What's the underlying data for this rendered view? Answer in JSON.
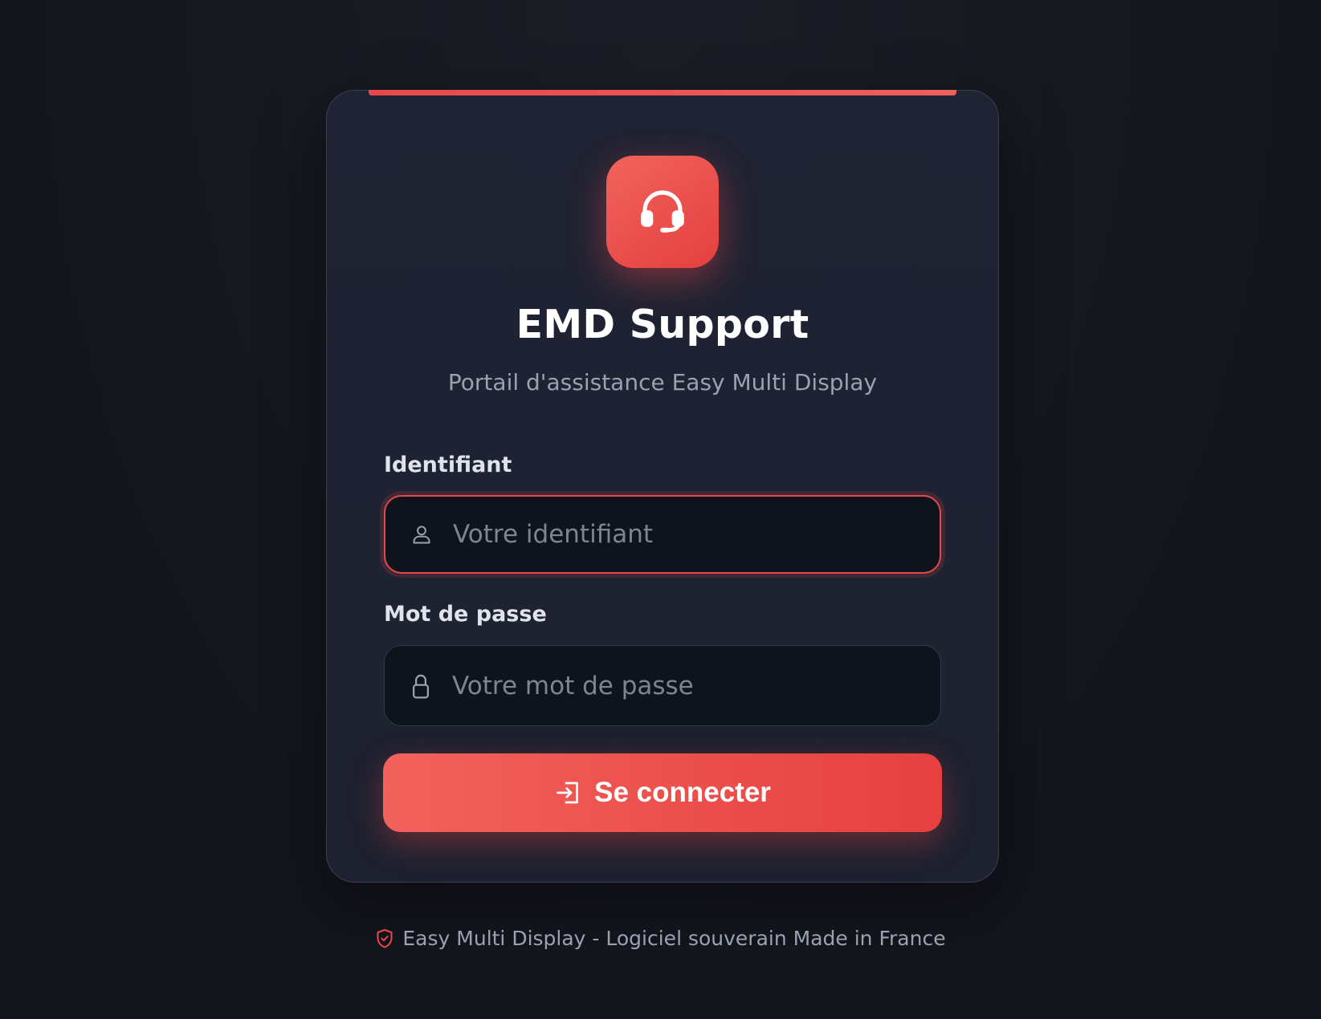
{
  "app": {
    "title": "EMD Support",
    "subtitle": "Portail d'assistance Easy Multi Display",
    "logo_icon": "headset-icon"
  },
  "form": {
    "username": {
      "label": "Identifiant",
      "placeholder": "Votre identifiant",
      "value": "",
      "icon": "user-icon",
      "focused": true
    },
    "password": {
      "label": "Mot de passe",
      "placeholder": "Votre mot de passe",
      "value": "",
      "icon": "lock-icon"
    },
    "submit": {
      "label": "Se connecter",
      "icon": "login-icon"
    }
  },
  "footer": {
    "text": "Easy Multi Display - Logiciel souverain Made in France",
    "icon": "shield-check-icon"
  },
  "colors": {
    "accent": "#e8484a",
    "accent_light": "#f2635c",
    "background": "#15171f",
    "card": "#1f2333",
    "input_bg": "#0f131b",
    "text_muted": "#9aa1b1"
  }
}
